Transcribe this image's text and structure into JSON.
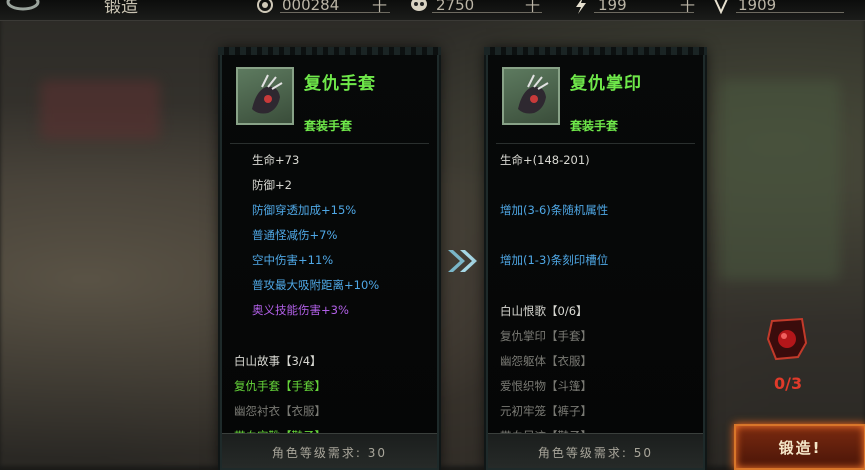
{
  "topbar": {
    "title": "锻造",
    "resources": [
      {
        "icon": "coin-icon",
        "value": "000284",
        "plus": "十"
      },
      {
        "icon": "skull-icon",
        "value": "2750",
        "plus": "十"
      },
      {
        "icon": "lightning-icon",
        "value": "199",
        "plus": "十"
      },
      {
        "icon": "gem-currency-icon",
        "value": "1909"
      }
    ]
  },
  "left_item": {
    "name": "复仇手套",
    "type": "套装手套",
    "stats": [
      {
        "text": "生命+73",
        "color": "white"
      },
      {
        "text": "防御+2",
        "color": "white"
      },
      {
        "text": "防御穿透加成+15%",
        "color": "blue"
      },
      {
        "text": "普通怪减伤+7%",
        "color": "blue"
      },
      {
        "text": "空中伤害+11%",
        "color": "blue"
      },
      {
        "text": "普攻最大吸附距离+10%",
        "color": "blue"
      },
      {
        "text": "奥义技能伤害+3%",
        "color": "purple"
      }
    ],
    "set_name": "白山故事【3/4】",
    "set_items": [
      {
        "text": "复仇手套【手套】",
        "active": true
      },
      {
        "text": "幽怨衬衣【衣服】",
        "active": false
      },
      {
        "text": "带血宝靴【鞋子】",
        "active": true
      }
    ],
    "requirement": "角色等级需求: 30"
  },
  "right_item": {
    "name": "复仇掌印",
    "type": "套装手套",
    "stats": [
      {
        "text": "生命+(148-201)",
        "color": "white"
      },
      {
        "text": "增加(3-6)条随机属性",
        "color": "blue"
      },
      {
        "text": "增加(1-3)条刻印槽位",
        "color": "blue"
      }
    ],
    "set_name": "白山恨歌【0/6】",
    "set_items": [
      {
        "text": "复仇掌印【手套】"
      },
      {
        "text": "幽怨躯体【衣服】"
      },
      {
        "text": "爱恨织物【斗篷】"
      },
      {
        "text": "元初牢笼【裤子】"
      },
      {
        "text": "带血足迹【鞋子】"
      }
    ],
    "requirement": "角色等级需求: 50"
  },
  "forge": {
    "count": "0/3",
    "button_label": "锻造!"
  },
  "colors": {
    "green": "#6fe84a",
    "blue": "#4fa8e6",
    "purple": "#b260e8",
    "accent": "#d8762a"
  }
}
